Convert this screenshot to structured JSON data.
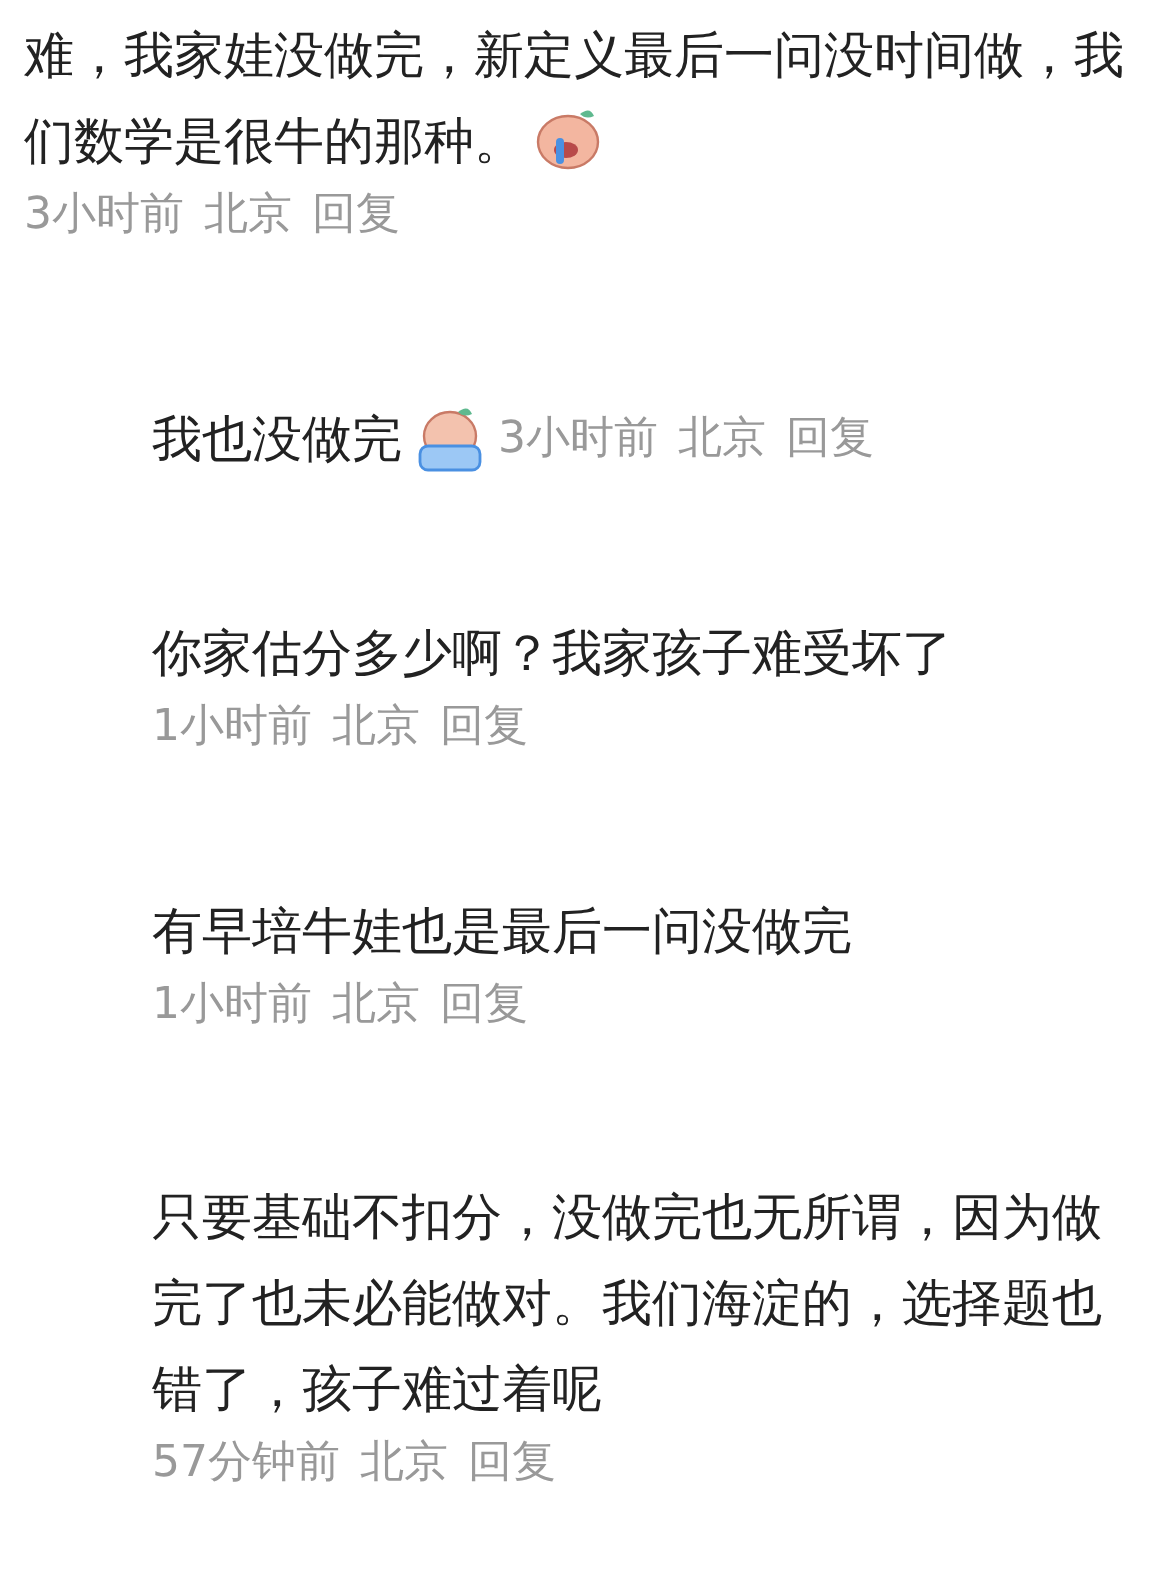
{
  "comment": {
    "text": "难，我家娃没做完，新定义最后一问没时间做，我们数学是很牛的那种。",
    "sticker": true,
    "time": "3小时前",
    "location": "北京",
    "reply": "回复"
  },
  "replies": [
    {
      "kind": "inline",
      "text": "我也没做完",
      "time": "3小时前",
      "location": "北京",
      "reply": "回复"
    },
    {
      "kind": "stacked",
      "text": "你家估分多少啊？我家孩子难受坏了",
      "time": "1小时前",
      "location": "北京",
      "reply": "回复"
    },
    {
      "kind": "stacked",
      "text": "有早培牛娃也是最后一问没做完",
      "time": "1小时前",
      "location": "北京",
      "reply": "回复"
    },
    {
      "kind": "stacked",
      "text": "只要基础不扣分，没做完也无所谓，因为做完了也未必能做对。我们海淀的，选择题也错了，孩子难过着呢",
      "time": "57分钟前",
      "location": "北京",
      "reply": "回复"
    }
  ]
}
